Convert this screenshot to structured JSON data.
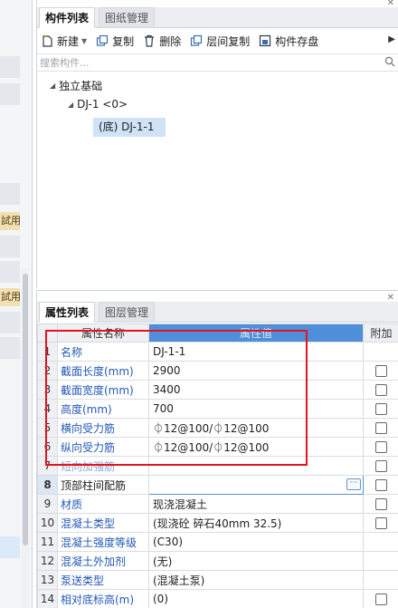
{
  "left_strip": {
    "tags": [
      "試用",
      "試用"
    ]
  },
  "top_panel": {
    "tabs": [
      {
        "label": "构件列表",
        "active": true
      },
      {
        "label": "图纸管理",
        "active": false
      }
    ],
    "toolbar": {
      "new_label": "新建",
      "copy_label": "复制",
      "delete_label": "删除",
      "floor_copy_label": "层间复制",
      "save_label": "构件存盘"
    },
    "search": {
      "placeholder": "搜索构件..."
    },
    "tree": {
      "root": "独立基础",
      "child": "DJ-1 <0>",
      "leaf": "(底) DJ-1-1"
    }
  },
  "bottom_panel": {
    "tabs": [
      {
        "label": "属性列表",
        "active": true
      },
      {
        "label": "图层管理",
        "active": false
      }
    ],
    "headers": {
      "name": "属性名称",
      "value": "属性值",
      "add": "附加"
    },
    "rows": [
      {
        "num": "1",
        "name": "名称",
        "value": "DJ-1-1"
      },
      {
        "num": "2",
        "name": "截面长度(mm)",
        "value": "2900"
      },
      {
        "num": "3",
        "name": "截面宽度(mm)",
        "value": "3400"
      },
      {
        "num": "4",
        "name": "高度(mm)",
        "value": "700"
      },
      {
        "num": "5",
        "name": "横向受力筋",
        "value": "⏀12@100/⏀12@100"
      },
      {
        "num": "6",
        "name": "纵向受力筋",
        "value": "⏀12@100/⏀12@100"
      },
      {
        "num": "7",
        "name": "短向加强筋",
        "value": ""
      },
      {
        "num": "8",
        "name": "顶部柱间配筋",
        "value": ""
      },
      {
        "num": "9",
        "name": "材质",
        "value": "现浇混凝土"
      },
      {
        "num": "10",
        "name": "混凝土类型",
        "value": "(现浇砼 碎石40mm 32.5)"
      },
      {
        "num": "11",
        "name": "混凝土强度等级",
        "value": "(C30)"
      },
      {
        "num": "12",
        "name": "混凝土外加剂",
        "value": "(无)"
      },
      {
        "num": "13",
        "name": "泵送类型",
        "value": "(混凝土泵)"
      },
      {
        "num": "14",
        "name": "相对底标高(m)",
        "value": "(0)"
      }
    ],
    "ellipsis_label": "···"
  }
}
